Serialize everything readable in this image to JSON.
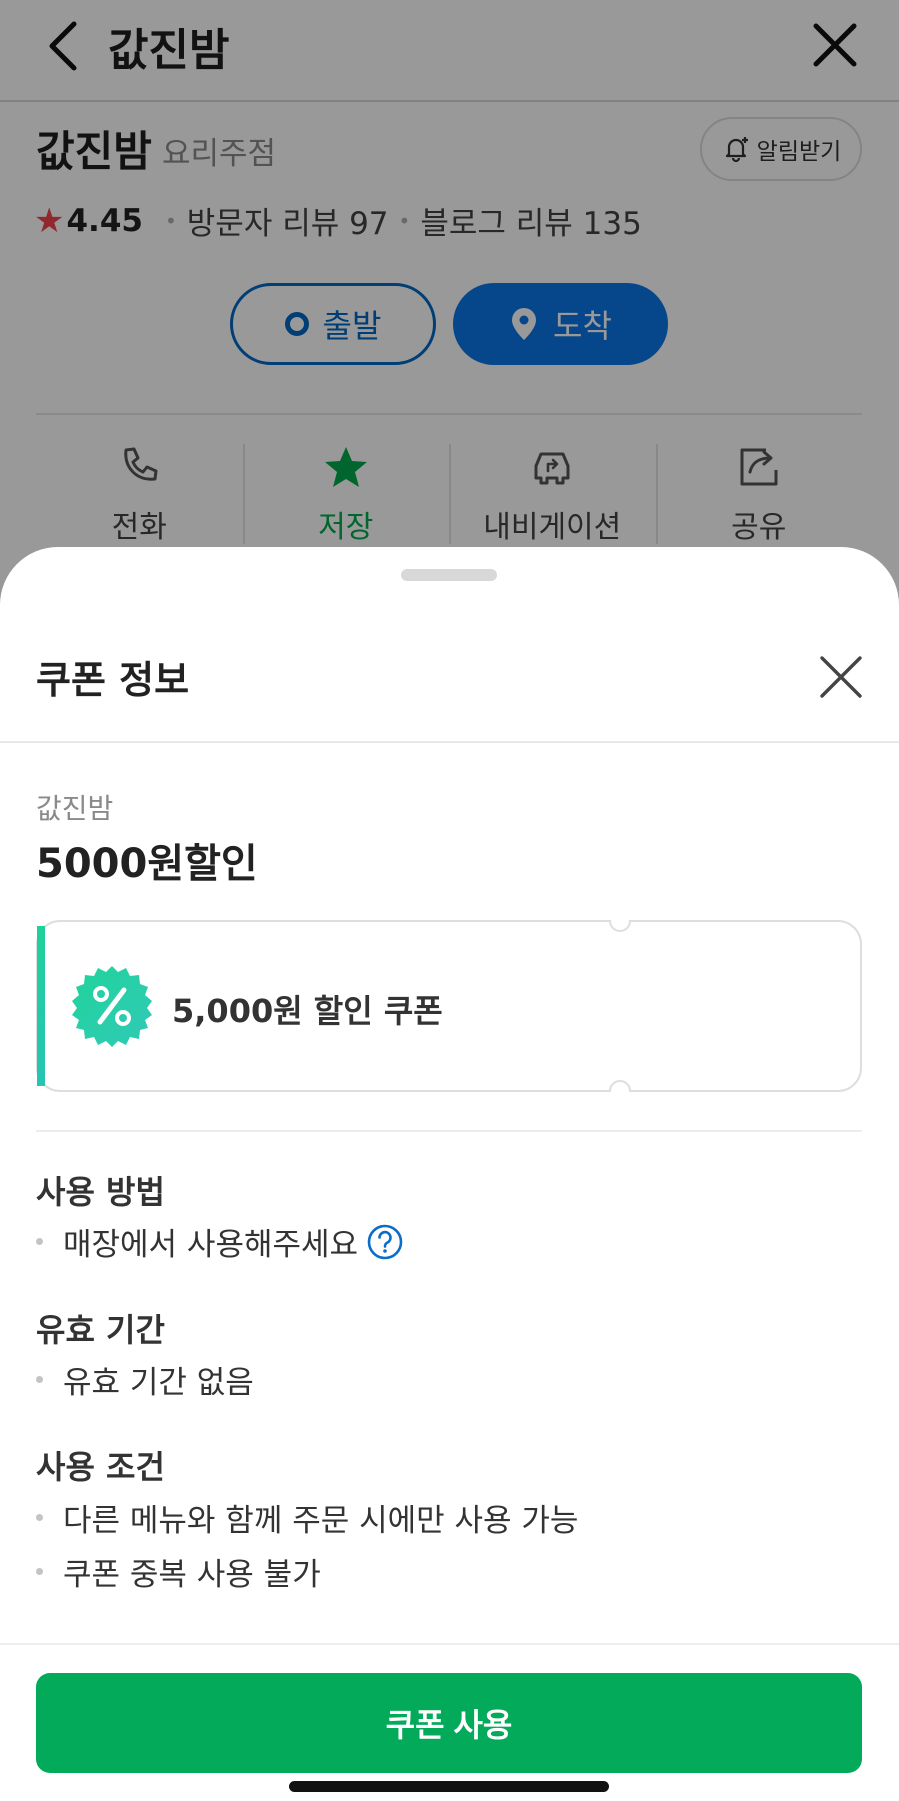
{
  "background_page": {
    "header": {
      "title": "값진밤"
    },
    "place": {
      "name": "값진밤",
      "category": "요리주점",
      "alarm_label": "알림받기"
    },
    "rating": {
      "score": "4.45",
      "visitor_reviews": "방문자 리뷰 97",
      "blog_reviews": "블로그 리뷰 135"
    },
    "route": {
      "start_label": "출발",
      "end_label": "도착"
    },
    "actions": [
      {
        "label": "전화",
        "icon": "phone-icon"
      },
      {
        "label": "저장",
        "icon": "star-icon"
      },
      {
        "label": "내비게이션",
        "icon": "car-icon"
      },
      {
        "label": "공유",
        "icon": "share-icon"
      }
    ]
  },
  "sheet": {
    "title": "쿠폰 정보",
    "shop_name": "값진밤",
    "coupon_name": "5000원할인",
    "coupon_card": {
      "description": "5,000원 할인 쿠폰",
      "badge_icon": "percent-icon"
    },
    "sections": [
      {
        "title": "사용 방법",
        "items": [
          "매장에서 사용해주세요"
        ]
      },
      {
        "title": "유효 기간",
        "items": [
          "유효 기간 없음"
        ]
      },
      {
        "title": "사용 조건",
        "items": [
          "다른 메뉴와 함께 주문 시에만 사용 가능",
          "쿠폰 중복 사용 불가"
        ]
      }
    ],
    "use_button_label": "쿠폰 사용"
  },
  "colors": {
    "brand_green": "#03aa5a",
    "route_blue": "#0b76e6",
    "star_red": "#f0434c",
    "saved_green": "#03a94d"
  }
}
